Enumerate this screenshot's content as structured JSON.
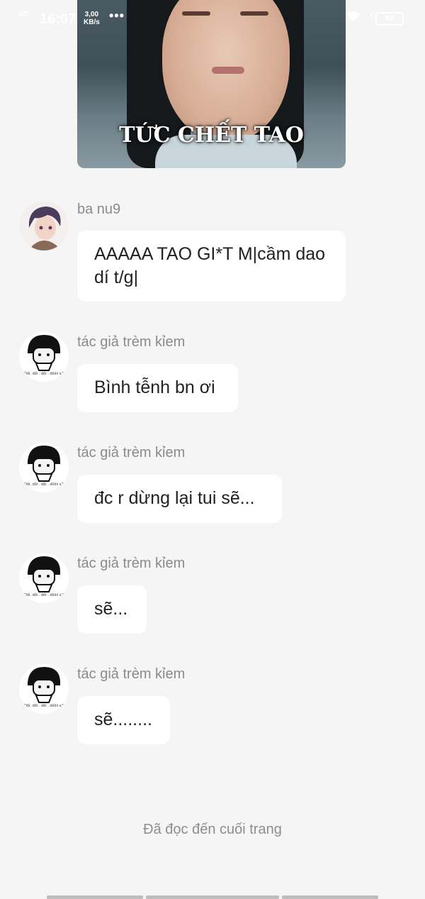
{
  "status_bar": {
    "signal": "4G",
    "time": "16:07",
    "speed_value": "3,00",
    "speed_unit": "KB/s",
    "more": "•••",
    "battery": "82"
  },
  "image_message": {
    "caption": "TỨC CHẾT TAO"
  },
  "messages": [
    {
      "sender": "ba nu9",
      "text": "AAAAA TAO GI*T M|cầm dao dí t/g|",
      "avatar_icon": "anime-boy-avatar"
    },
    {
      "sender": "tác giả trèm kỉem",
      "text": "Bình tễnh bn ơi",
      "avatar_icon": "meme-face-avatar"
    },
    {
      "sender": "tác giả trèm kỉem",
      "text": "đc r dừng lại tui sẽ...",
      "avatar_icon": "meme-face-avatar"
    },
    {
      "sender": "tác giả trèm kỉem",
      "text": "sẽ...",
      "avatar_icon": "meme-face-avatar"
    },
    {
      "sender": "tác giả trèm kỉem",
      "text": "sẽ........",
      "avatar_icon": "meme-face-avatar"
    }
  ],
  "footer": {
    "end_text": "Đã đọc đến cuối trang"
  }
}
